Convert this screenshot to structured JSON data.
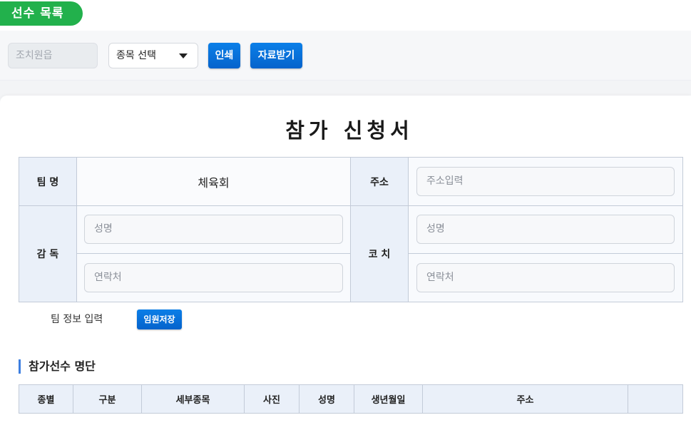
{
  "header": {
    "title": "선수 목록"
  },
  "toolbar": {
    "region_value": "조치원읍",
    "event_select": "종목 선택",
    "print_label": "인쇄",
    "download_label": "자료받기"
  },
  "form": {
    "title": "참가 신청서",
    "team_label": "팀 명",
    "team_value": "체육회",
    "address_label": "주소",
    "address_placeholder": "주소입력",
    "director_label": "감 독",
    "coach_label": "코 치",
    "name_placeholder": "성명",
    "contact_placeholder": "연락처",
    "team_info_label": "팀 정보 입력",
    "save_staff_label": "임원저장"
  },
  "roster": {
    "title": "참가선수 명단",
    "columns": [
      "종별",
      "구분",
      "세부종목",
      "사진",
      "성명",
      "생년월일",
      "주소",
      ""
    ]
  }
}
